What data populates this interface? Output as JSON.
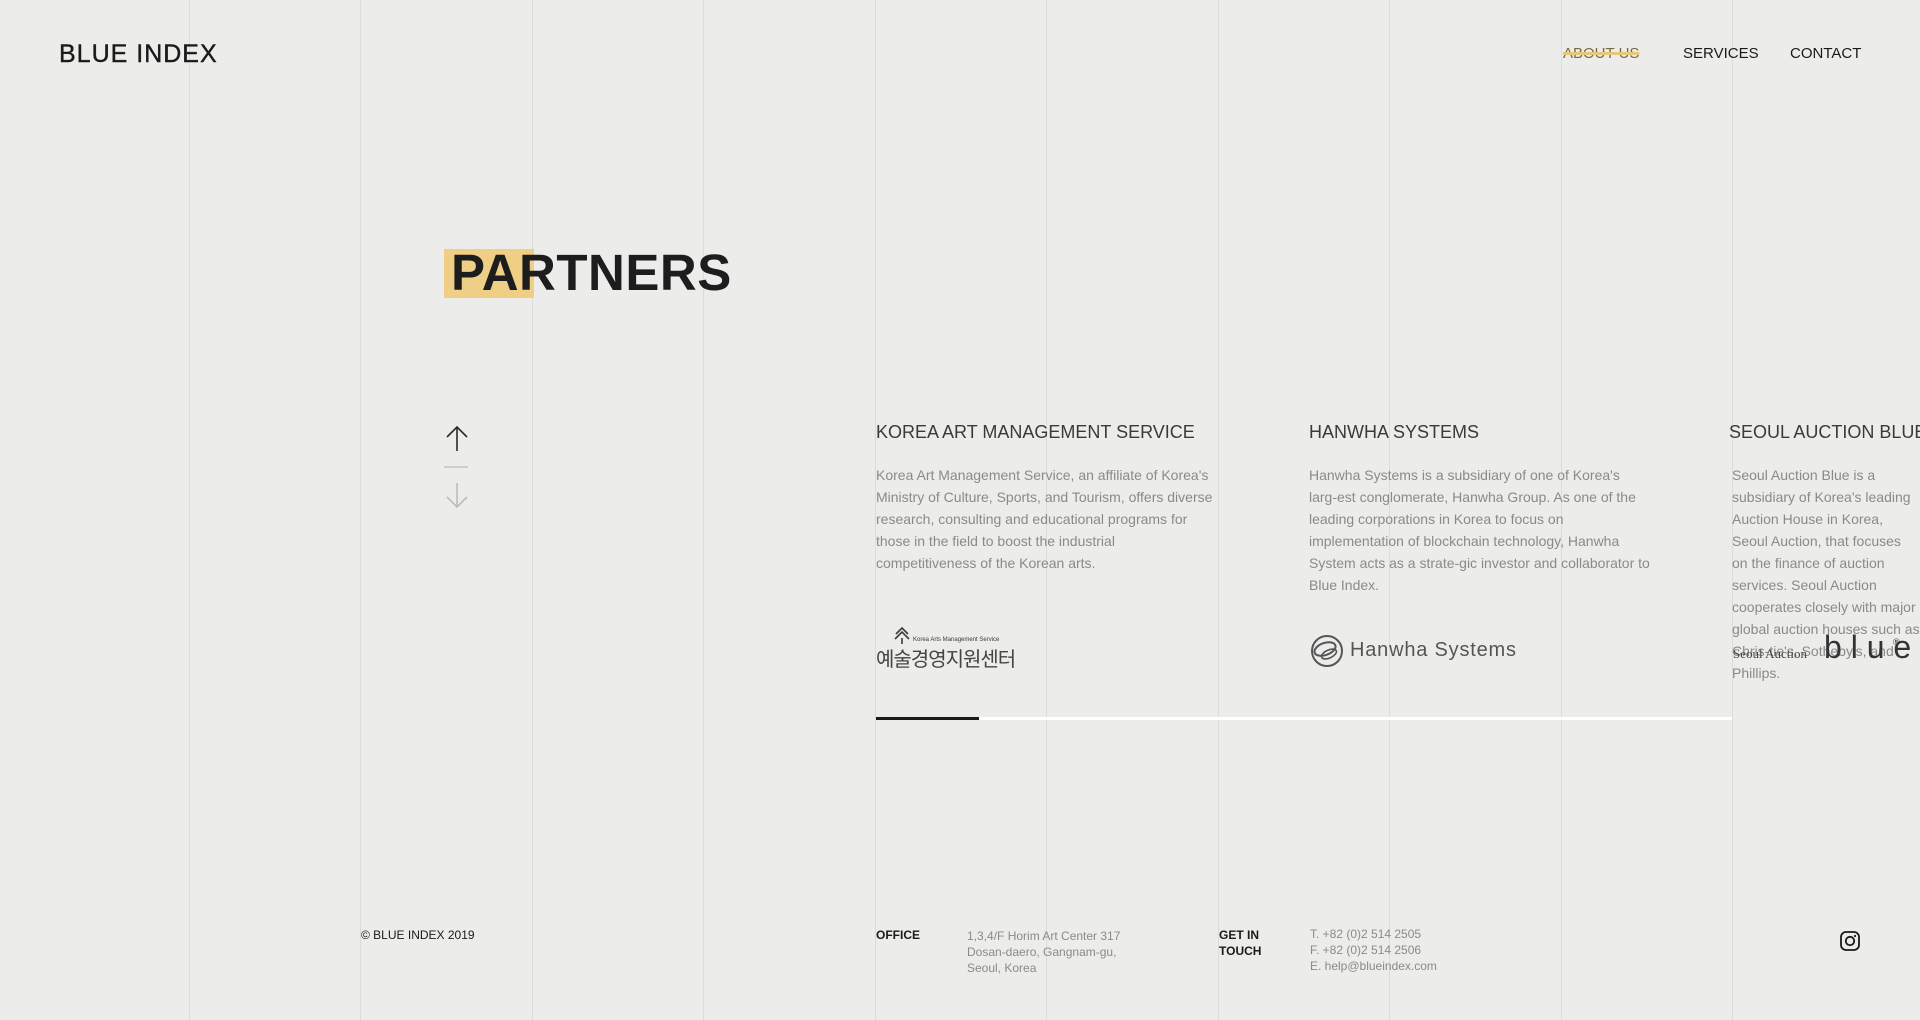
{
  "header": {
    "logo": "BLUE INDEX",
    "nav": [
      {
        "label": "ABOUT US",
        "active": true
      },
      {
        "label": "SERVICES",
        "active": false
      },
      {
        "label": "CONTACT",
        "active": false
      }
    ]
  },
  "main": {
    "title": "PARTNERS",
    "partners": [
      {
        "name": "KOREA ART MANAGEMENT SERVICE",
        "description": "Korea Art Management Service, an affiliate of Korea's Ministry of Culture, Sports, and Tourism, offers diverse research, consulting and educational programs for those in the field to boost the industrial competitiveness of the Korean arts.",
        "logo_text_small": "Korea Arts Management Service",
        "logo_text_main": "예술경영지원센터"
      },
      {
        "name": "HANWHA SYSTEMS",
        "description": "Hanwha Systems is a subsidiary of one of Korea's larg-est conglomerate, Hanwha Group. As one of the leading corporations in Korea to focus on implementation of blockchain technology, Hanwha System acts as a strate-gic investor and collaborator to Blue Index.",
        "logo_text": "Hanwha Systems"
      },
      {
        "name": "SEOUL AUCTION BLUE",
        "description": "Seoul Auction Blue is a subsidiary of Korea's leading Auction House in Korea, Seoul Auction, that focuses on the finance of auction services. Seoul Auction cooperates closely with major global auction houses such as Chris-tie's, Sotheby's, and Phillips.",
        "logo_text_small": "Seoul Auction",
        "logo_text_main": "b l u e",
        "logo_mark": "®"
      }
    ],
    "carousel_progress": 0.12
  },
  "footer": {
    "copyright": "© BLUE INDEX 2019",
    "office_label": "OFFICE",
    "office_lines": [
      "1,3,4/F Horim Art Center 317",
      "Dosan-daero, Gangnam-gu,",
      "Seoul, Korea"
    ],
    "contact_label_1": "GET IN",
    "contact_label_2": "TOUCH",
    "contact_lines": [
      "T. +82 (0)2 514 2505",
      "F. +82 (0)2 514 2506",
      "E. help@blueindex.com"
    ]
  },
  "icons": {
    "scroll_up": "arrow-up-icon",
    "scroll_down": "arrow-down-icon",
    "social": "instagram-icon"
  },
  "colors": {
    "background": "#ececea",
    "highlight": "#efcf85",
    "text": "#1f1f1f",
    "muted": "#8a8a88"
  }
}
